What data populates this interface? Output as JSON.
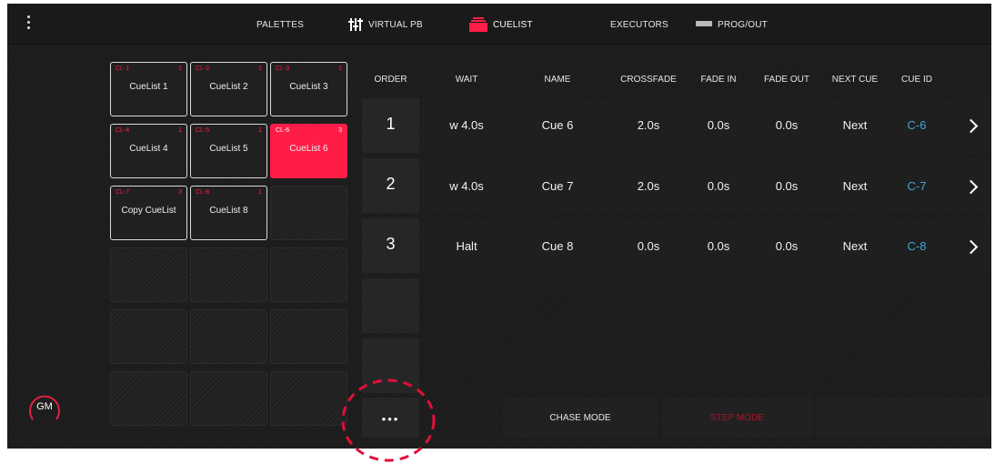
{
  "topbar": {
    "menu_icon": "vertical-dots-icon",
    "nav": [
      {
        "label": "PALETTES",
        "icon": "grid-icon"
      },
      {
        "label": "VIRTUAL PB",
        "icon": "sliders-icon"
      },
      {
        "label": "CUELIST",
        "icon": "cuelist-icon",
        "active": true
      },
      {
        "label": "EXECUTORS",
        "icon": "executors-icon"
      },
      {
        "label": "PROG/OUT",
        "icon": "prog-out-icon"
      }
    ]
  },
  "pool": {
    "tiles": [
      {
        "id": "CL-1",
        "count": "1",
        "name": "CueList 1"
      },
      {
        "id": "CL-2",
        "count": "1",
        "name": "CueList 2"
      },
      {
        "id": "CL-3",
        "count": "1",
        "name": "CueList 3"
      },
      {
        "id": "CL-4",
        "count": "1",
        "name": "CueList 4"
      },
      {
        "id": "CL-5",
        "count": "1",
        "name": "CueList 5"
      },
      {
        "id": "CL-6",
        "count": "3",
        "name": "CueList 6",
        "selected": true
      },
      {
        "id": "CL-7",
        "count": "3",
        "name": "Copy CueList"
      },
      {
        "id": "CL-8",
        "count": "1",
        "name": "CueList 8"
      }
    ]
  },
  "gm": {
    "label": "GM"
  },
  "table": {
    "headers": [
      "ORDER",
      "WAIT",
      "NAME",
      "CROSSFADE",
      "FADE IN",
      "FADE OUT",
      "NEXT CUE",
      "CUE ID"
    ],
    "rows": [
      {
        "order": "1",
        "wait": "w 4.0s",
        "name": "Cue 6",
        "crossfade": "2.0s",
        "fade_in": "0.0s",
        "fade_out": "0.0s",
        "next_cue": "Next",
        "cue_id": "C-6"
      },
      {
        "order": "2",
        "wait": "w 4.0s",
        "name": "Cue 7",
        "crossfade": "2.0s",
        "fade_in": "0.0s",
        "fade_out": "0.0s",
        "next_cue": "Next",
        "cue_id": "C-7"
      },
      {
        "order": "3",
        "wait": "Halt",
        "name": "Cue 8",
        "crossfade": "0.0s",
        "fade_in": "0.0s",
        "fade_out": "0.0s",
        "next_cue": "Next",
        "cue_id": "C-8"
      }
    ]
  },
  "bottom": {
    "more_label": "•••",
    "chase_mode": "CHASE MODE",
    "step_mode": "STEP MODE"
  },
  "colors": {
    "accent": "#ff1d47",
    "cue_id": "#3fa4d6",
    "background": "#1c1c1c"
  }
}
